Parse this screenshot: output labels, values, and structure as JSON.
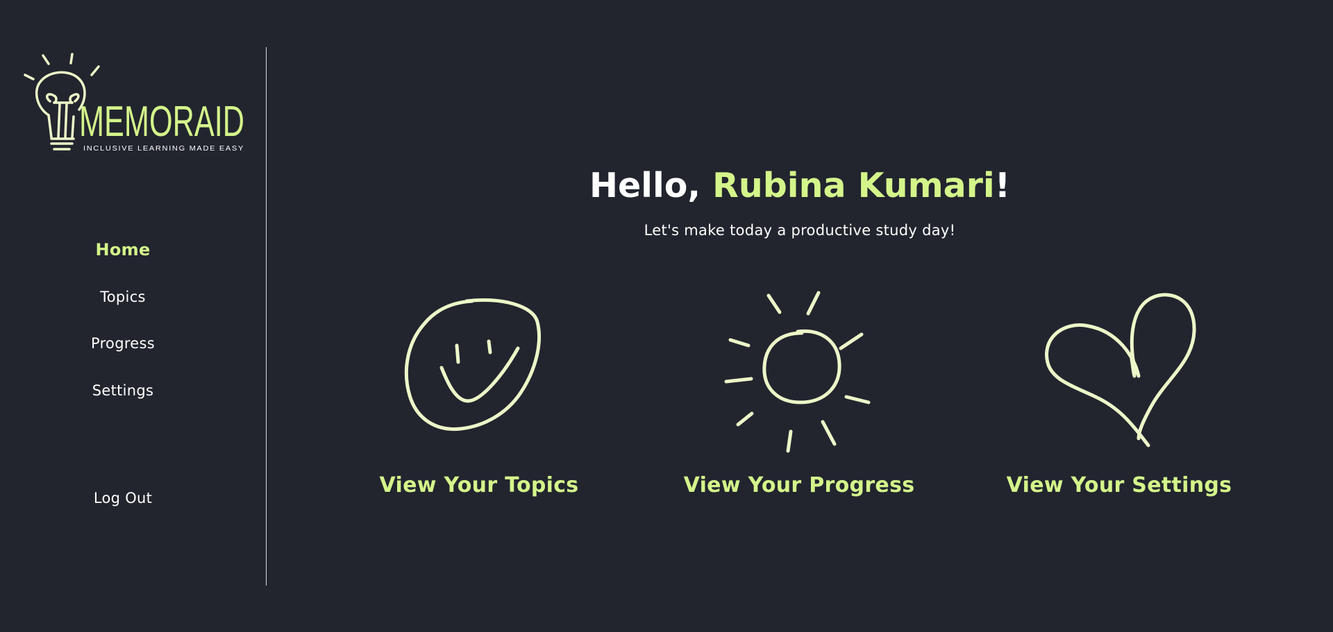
{
  "brand": {
    "name": "MEMORAID",
    "tagline": "INCLUSIVE LEARNING MADE EASY"
  },
  "colors": {
    "background": "#22252e",
    "accent": "#d4f58a",
    "icon_stroke": "#ecf8c8",
    "text": "#ffffff"
  },
  "sidebar": {
    "items": [
      {
        "label": "Home",
        "active": true
      },
      {
        "label": "Topics",
        "active": false
      },
      {
        "label": "Progress",
        "active": false
      },
      {
        "label": "Settings",
        "active": false
      }
    ],
    "logout_label": "Log Out"
  },
  "main": {
    "greeting_prefix": "Hello, ",
    "user_name": "Rubina Kumari",
    "greeting_suffix": "!",
    "subtitle": "Let's make today a productive study day!",
    "cards": [
      {
        "label": "View Your Topics",
        "icon": "smiley-icon"
      },
      {
        "label": "View Your Progress",
        "icon": "sun-icon"
      },
      {
        "label": "View Your Settings",
        "icon": "heart-icon"
      }
    ]
  }
}
